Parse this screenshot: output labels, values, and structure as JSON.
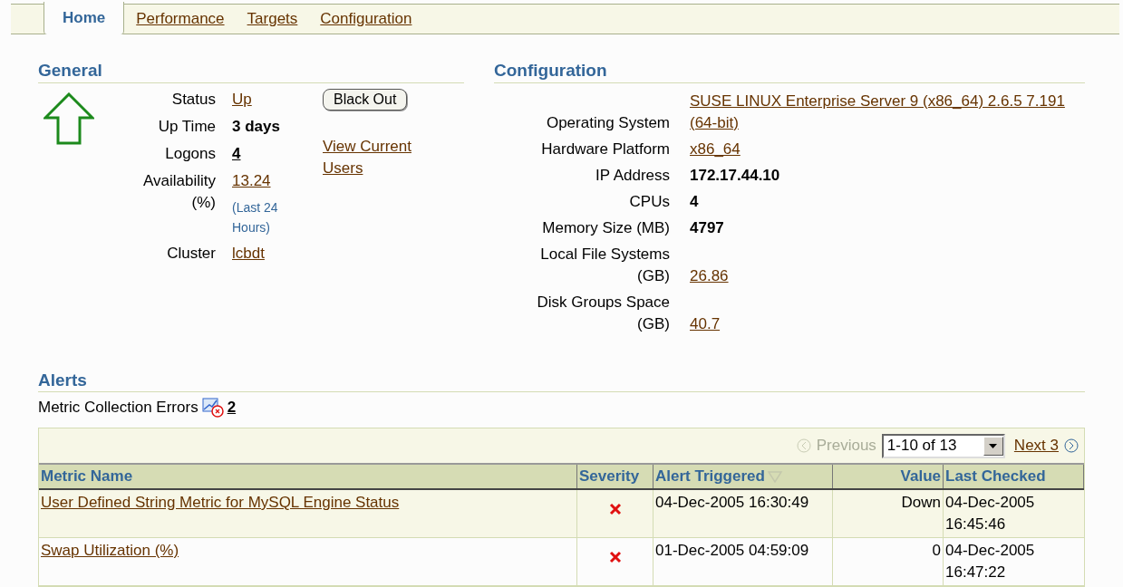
{
  "tabs": [
    {
      "label": "Home",
      "selected": true
    },
    {
      "label": "Performance",
      "selected": false
    },
    {
      "label": "Targets",
      "selected": false
    },
    {
      "label": "Configuration",
      "selected": false
    }
  ],
  "general": {
    "title": "General",
    "status_up": true,
    "fields": [
      {
        "label": "Status",
        "value": "Up",
        "kind": "link"
      },
      {
        "label": "Up Time",
        "value": "3 days",
        "kind": "bold"
      },
      {
        "label": "Logons",
        "value": "4",
        "kind": "bold_link"
      },
      {
        "label": "Availability (%)",
        "value": "13.24",
        "kind": "link",
        "note": "(Last 24 Hours)"
      },
      {
        "label": "Cluster",
        "value": "lcbdt",
        "kind": "link"
      }
    ],
    "blackout_button": "Black Out",
    "view_users_link": "View Current Users"
  },
  "configuration": {
    "title": "Configuration",
    "fields": [
      {
        "label": "Operating System",
        "value": "SUSE LINUX Enterprise Server 9 (x86_64) 2.6.5 7.191 (64-bit)",
        "kind": "link"
      },
      {
        "label": "Hardware Platform",
        "value": "x86_64",
        "kind": "link"
      },
      {
        "label": "IP Address",
        "value": "172.17.44.10",
        "kind": "bold"
      },
      {
        "label": "CPUs",
        "value": "4",
        "kind": "bold"
      },
      {
        "label": "Memory Size (MB)",
        "value": "4797",
        "kind": "bold"
      },
      {
        "label": "Local File Systems (GB)",
        "value": "26.86",
        "kind": "link"
      },
      {
        "label": "Disk Groups Space (GB)",
        "value": "40.7",
        "kind": "link"
      }
    ]
  },
  "alerts": {
    "title": "Alerts",
    "metric_errors_label": "Metric Collection Errors",
    "metric_errors_count": "2",
    "pagination": {
      "previous": "Previous",
      "range": "1-10 of 13",
      "next": "Next 3"
    },
    "columns": [
      {
        "label": "Metric Name",
        "sorted": false
      },
      {
        "label": "Severity",
        "sorted": false
      },
      {
        "label": "Alert Triggered",
        "sorted": true
      },
      {
        "label": "Value",
        "sorted": false
      },
      {
        "label": "Last Checked",
        "sorted": false
      }
    ],
    "rows": [
      {
        "metric": "User Defined String Metric for MySQL Engine Status",
        "critical": true,
        "triggered": "04-Dec-2005 16:30:49",
        "value": "Down",
        "last_checked": "04-Dec-2005 16:45:46"
      },
      {
        "metric": "Swap Utilization (%)",
        "critical": true,
        "triggered": "01-Dec-2005 04:59:09",
        "value": "0",
        "last_checked": "04-Dec-2005 16:47:22"
      }
    ]
  }
}
